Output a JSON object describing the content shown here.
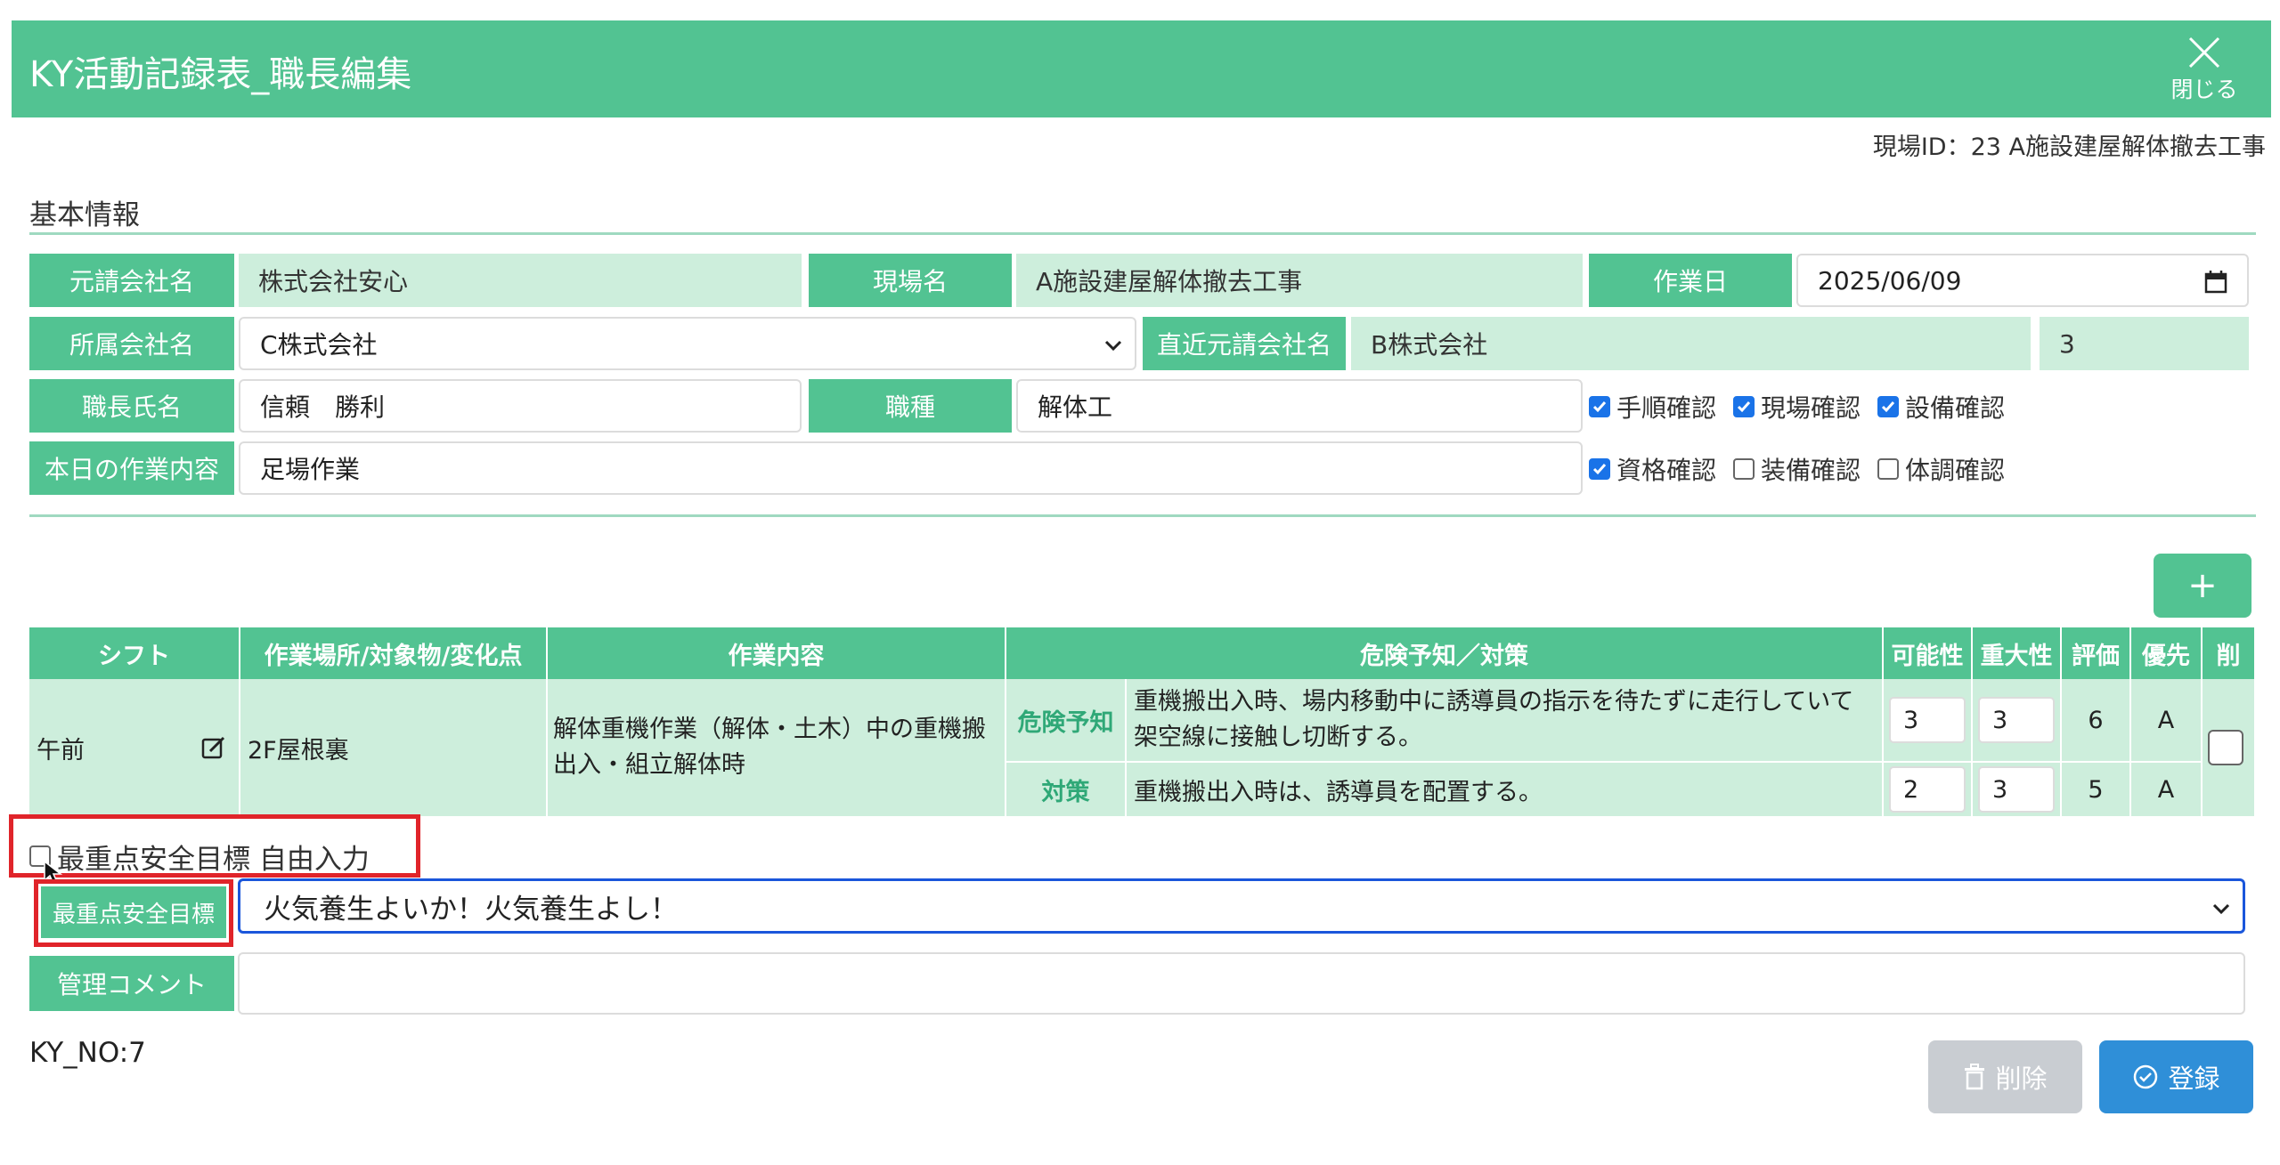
{
  "header": {
    "title": "KY活動記録表_職長編集",
    "close_label": "閉じる"
  },
  "site_id": "現場ID：23 A施設建屋解体撤去工事",
  "section_title": "基本情報",
  "basic": {
    "prime_company_label": "元請会社名",
    "prime_company": "株式会社安心",
    "site_name_label": "現場名",
    "site_name": "A施設建屋解体撤去工事",
    "work_date_label": "作業日",
    "work_date": "2025/06/09",
    "affiliate_label": "所属会社名",
    "affiliate": "C株式会社",
    "direct_prime_label": "直近元請会社名",
    "direct_prime": "B株式会社",
    "direct_prime_num": "3",
    "foreman_label": "職長氏名",
    "foreman": "信頼　勝利",
    "job_type_label": "職種",
    "job_type": "解体工",
    "today_work_label": "本日の作業内容",
    "today_work": "足場作業"
  },
  "checks": [
    {
      "label": "手順確認",
      "checked": true
    },
    {
      "label": "現場確認",
      "checked": true
    },
    {
      "label": "設備確認",
      "checked": true
    },
    {
      "label": "資格確認",
      "checked": true
    },
    {
      "label": "装備確認",
      "checked": false
    },
    {
      "label": "体調確認",
      "checked": false
    }
  ],
  "add_label": "+",
  "table": {
    "headers": [
      "シフト",
      "作業場所/対象物/変化点",
      "作業内容",
      "危険予知／対策",
      "可能性",
      "重大性",
      "評価",
      "優先",
      "削"
    ],
    "row": {
      "shift": "午前",
      "place": "2F屋根裏",
      "work": "解体重機作業（解体・土木）中の重機搬出入・組立解体時",
      "hazard_tag": "危険予知",
      "hazard_text": "重機搬出入時、場内移動中に誘導員の指示を待たずに走行していて架空線に接触し切断する。",
      "hazard_possibility": "3",
      "hazard_severity": "3",
      "hazard_eval": "6",
      "hazard_priority": "A",
      "measure_tag": "対策",
      "measure_text": "重機搬出入時は、誘導員を配置する。",
      "measure_possibility": "2",
      "measure_severity": "3",
      "measure_eval": "5",
      "measure_priority": "A"
    }
  },
  "goal": {
    "free_input_label": "最重点安全目標 自由入力",
    "label": "最重点安全目標",
    "value": "火気養生よいか！火気養生よし！"
  },
  "comment_label": "管理コメント",
  "ky_no": "KY_NO:7",
  "buttons": {
    "delete": "削除",
    "save": "登録"
  },
  "colors": {
    "accent": "#52c392",
    "readonly_bg": "#cdeedc",
    "primary": "#2f8fd8",
    "highlight": "#e0242a"
  }
}
